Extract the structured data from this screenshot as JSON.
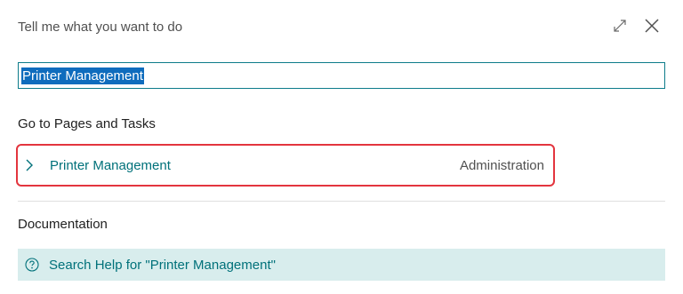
{
  "header": {
    "title": "Tell me what you want to do",
    "icons": [
      "expand-icon",
      "close-icon"
    ]
  },
  "search": {
    "value": "Printer Management",
    "selected": true
  },
  "pages_section": {
    "title": "Go to Pages and Tasks",
    "results": [
      {
        "name": "Printer Management",
        "category": "Administration"
      }
    ]
  },
  "docs_section": {
    "title": "Documentation",
    "help_link": "Search Help for \"Printer Management\""
  },
  "colors": {
    "accent": "#00717a",
    "selection": "#0f6cbd",
    "highlight_border": "#e3353e",
    "help_background": "#d8eded"
  }
}
